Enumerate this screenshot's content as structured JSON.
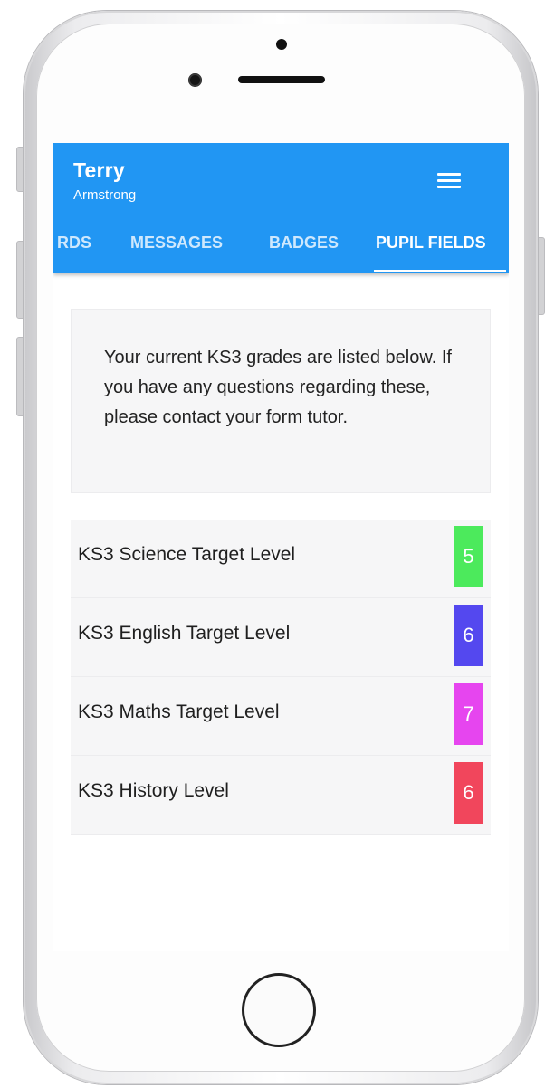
{
  "user": {
    "first_name": "Terry",
    "last_name": "Armstrong"
  },
  "header": {
    "menu_icon": "hamburger-menu-icon"
  },
  "tabs": [
    {
      "label": "RDS"
    },
    {
      "label": "MESSAGES"
    },
    {
      "label": "BADGES"
    },
    {
      "label": "PUPIL FIELDS",
      "active": true
    }
  ],
  "info": {
    "text": "Your current KS3 grades are listed below. If you have any questions regarding these, please contact your form tutor."
  },
  "fields": [
    {
      "label": "KS3 Science Target Level",
      "value": "5",
      "color": "#4cea5c"
    },
    {
      "label": "KS3 English Target Level",
      "value": "6",
      "color": "#5448ef"
    },
    {
      "label": "KS3 Maths Target Level",
      "value": "7",
      "color": "#e645ef"
    },
    {
      "label": "KS3 History Level",
      "value": "6",
      "color": "#f1465c"
    }
  ],
  "colors": {
    "app_bar": "#2196f3"
  }
}
